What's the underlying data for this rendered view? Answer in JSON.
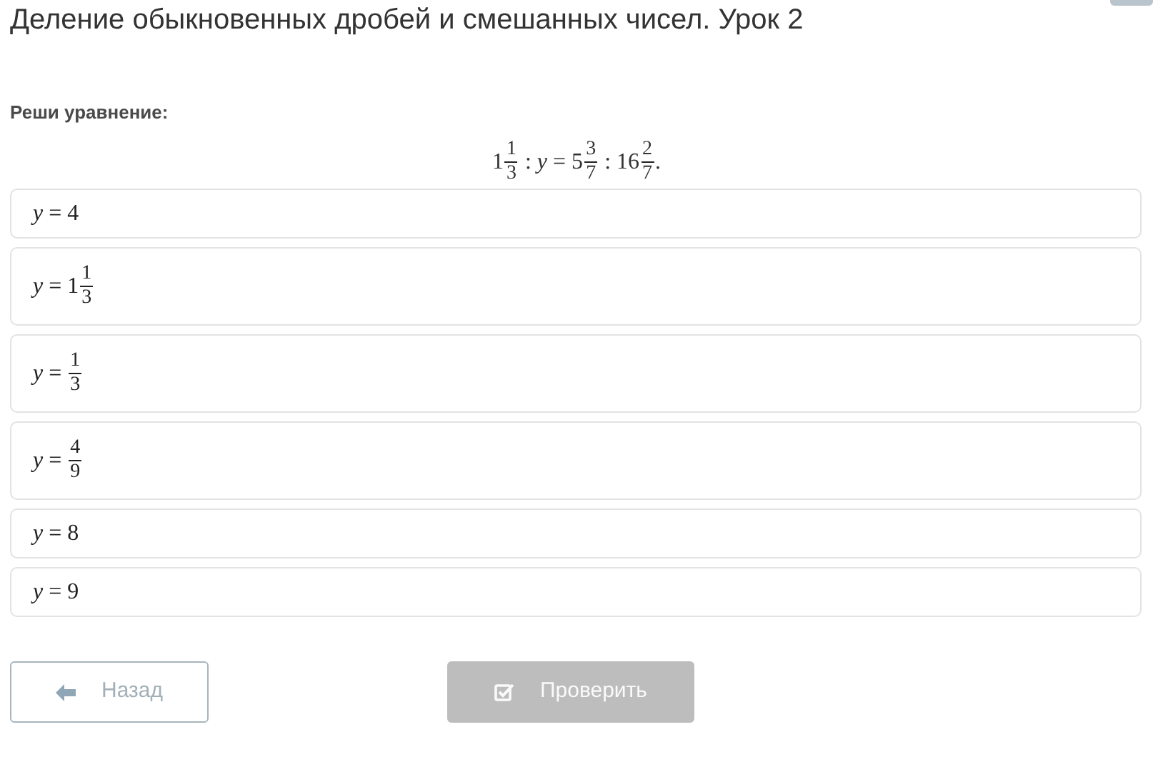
{
  "title": "Деление обыкновенных дробей и смешанных чисел. Урок 2",
  "prompt": "Реши уравнение:",
  "equation": [
    {
      "kind": "text",
      "text": "1"
    },
    {
      "kind": "frac",
      "num": "1",
      "den": "3"
    },
    {
      "kind": "text",
      "text": " : "
    },
    {
      "kind": "var",
      "text": "y"
    },
    {
      "kind": "text",
      "text": " = 5"
    },
    {
      "kind": "frac",
      "num": "3",
      "den": "7"
    },
    {
      "kind": "text",
      "text": " : 16"
    },
    {
      "kind": "frac",
      "num": "2",
      "den": "7"
    },
    {
      "kind": "text",
      "text": "."
    }
  ],
  "options": [
    {
      "tokens": [
        {
          "kind": "var",
          "text": "y"
        },
        {
          "kind": "text",
          "text": " = 4"
        }
      ]
    },
    {
      "tokens": [
        {
          "kind": "var",
          "text": "y"
        },
        {
          "kind": "text",
          "text": " = 1"
        },
        {
          "kind": "frac",
          "num": "1",
          "den": "3"
        }
      ]
    },
    {
      "tokens": [
        {
          "kind": "var",
          "text": "y"
        },
        {
          "kind": "text",
          "text": " = "
        },
        {
          "kind": "frac",
          "num": "1",
          "den": "3"
        }
      ]
    },
    {
      "tokens": [
        {
          "kind": "var",
          "text": "y"
        },
        {
          "kind": "text",
          "text": " = "
        },
        {
          "kind": "frac",
          "num": "4",
          "den": "9"
        }
      ]
    },
    {
      "tokens": [
        {
          "kind": "var",
          "text": "y"
        },
        {
          "kind": "text",
          "text": " = 8"
        }
      ]
    },
    {
      "tokens": [
        {
          "kind": "var",
          "text": "y"
        },
        {
          "kind": "text",
          "text": " = 9"
        }
      ]
    }
  ],
  "back_button": {
    "label": "Назад"
  },
  "check_button": {
    "label": "Проверить",
    "disabled": true
  }
}
